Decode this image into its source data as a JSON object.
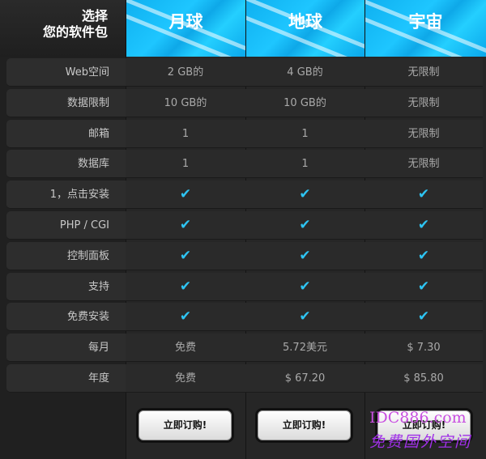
{
  "header": {
    "title_line1": "选择",
    "title_line2": "您的软件包",
    "plans": [
      "月球",
      "地球",
      "宇宙"
    ]
  },
  "rows": [
    {
      "feature": "Web空间",
      "values": [
        "2 GB的",
        "4 GB的",
        "无限制"
      ]
    },
    {
      "feature": "数据限制",
      "values": [
        "10 GB的",
        "10 GB的",
        "无限制"
      ]
    },
    {
      "feature": "邮箱",
      "values": [
        "1",
        "1",
        "无限制"
      ]
    },
    {
      "feature": "数据库",
      "values": [
        "1",
        "1",
        "无限制"
      ]
    },
    {
      "feature": "1，点击安装",
      "values": [
        "✔",
        "✔",
        "✔"
      ]
    },
    {
      "feature": "PHP / CGI",
      "values": [
        "✔",
        "✔",
        "✔"
      ]
    },
    {
      "feature": "控制面板",
      "values": [
        "✔",
        "✔",
        "✔"
      ]
    },
    {
      "feature": "支持",
      "values": [
        "✔",
        "✔",
        "✔"
      ]
    },
    {
      "feature": "免费安装",
      "values": [
        "✔",
        "✔",
        "✔"
      ]
    },
    {
      "feature": "每月",
      "values": [
        "免费",
        "5.72美元",
        "$ 7.30"
      ]
    },
    {
      "feature": "年度",
      "values": [
        "免费",
        "$ 67.20",
        "$ 85.80"
      ]
    }
  ],
  "buttons": {
    "order_label": "立即订购!"
  },
  "watermark": {
    "line1": "IDC886.com",
    "line2": "免费国外空间"
  },
  "colors": {
    "accent": "#1ec6ff",
    "check": "#2ec4f2"
  }
}
